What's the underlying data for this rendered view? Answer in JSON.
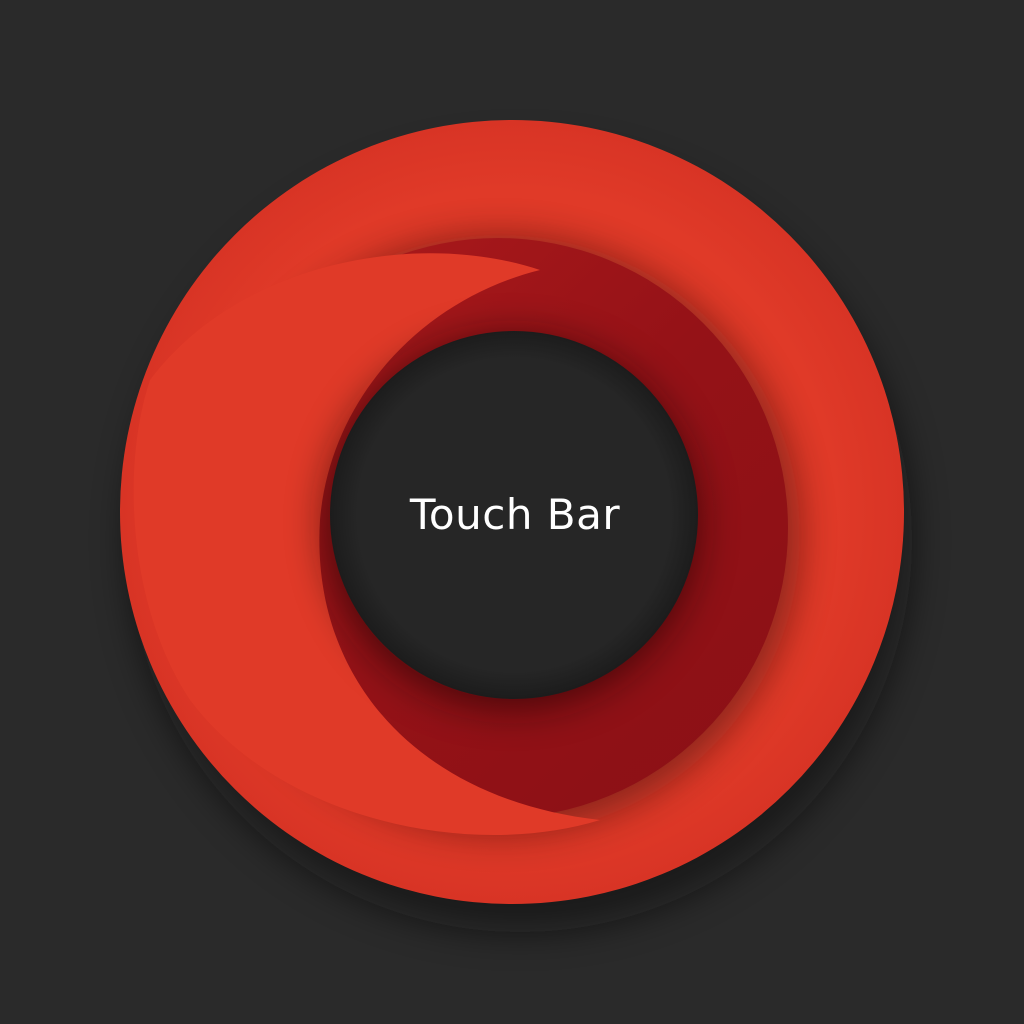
{
  "app": {
    "title": "Touch Bar"
  },
  "colors": {
    "background": "#2a2a2a",
    "ring_light": "#e03a28",
    "ring_dark": "#9a1418",
    "hole": "#262626",
    "text": "#ffffff"
  },
  "icon": {
    "name": "touch-bar-ring-icon"
  }
}
